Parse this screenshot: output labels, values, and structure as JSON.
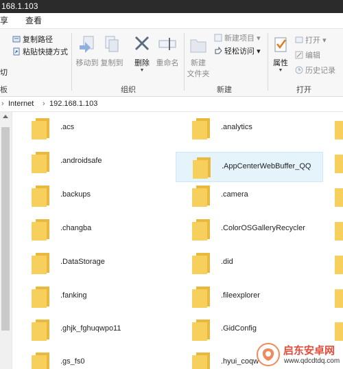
{
  "window": {
    "title_fragment": "168.1.103"
  },
  "menu_tabs": [
    "享",
    "查看"
  ],
  "ribbon": {
    "clipboard": {
      "copy_path": "复制路径",
      "paste_shortcut": "粘贴快捷方式",
      "cut_fragment": "切",
      "group_fragment": "板"
    },
    "organize": {
      "move_to": "移动到",
      "copy_to": "复制到",
      "delete": "删除",
      "rename": "重命名",
      "group": "组织"
    },
    "new": {
      "new_folder_line1": "新建",
      "new_folder_line2": "文件夹",
      "new_item": "新建项目",
      "easy_access": "轻松访问",
      "group": "新建"
    },
    "open": {
      "properties": "属性",
      "open": "打开",
      "edit": "编辑",
      "history": "历史记录",
      "group": "打开"
    }
  },
  "address": {
    "segments": [
      "Internet",
      "192.168.1.103"
    ]
  },
  "folders_left": [
    ".acs",
    ".androidsafe",
    ".backups",
    ".changba",
    ".DataStorage",
    ".fanking",
    ".ghjk_fghuqwpo11",
    ".gs_fs0"
  ],
  "folders_right": [
    ".analytics",
    ".AppCenterWebBuffer_QQ",
    ".camera",
    ".ColorOSGalleryRecycler",
    ".did",
    ".fileexplorer",
    ".GidConfig",
    ".hyui_coqw"
  ],
  "selected_folder": ".AppCenterWebBuffer_QQ",
  "watermark": {
    "title": "启东安卓网",
    "url": "www.qdcdtdq.com"
  },
  "colors": {
    "folder": "#f6cf5c",
    "selection": "#e5f3fb",
    "title_bar": "#2b2b2b",
    "accent": "#e64b3c"
  }
}
